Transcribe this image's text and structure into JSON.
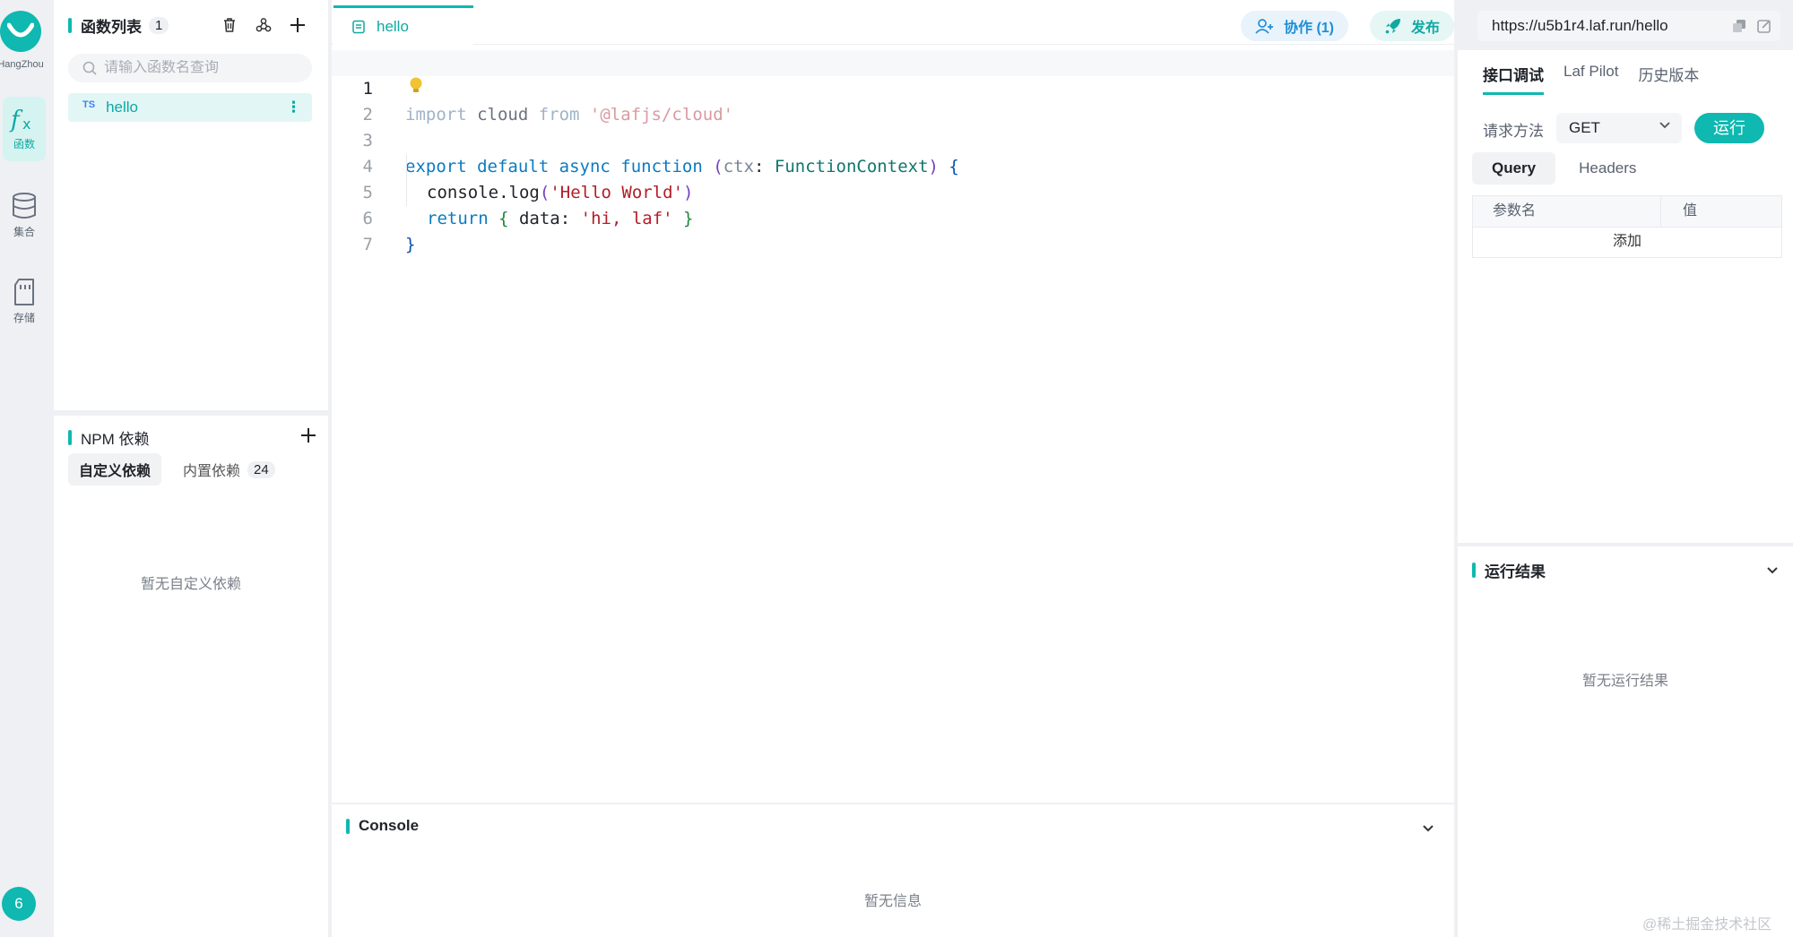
{
  "rail": {
    "region": "HangZhou",
    "items": [
      {
        "label": "函数",
        "active": true
      },
      {
        "label": "集合",
        "active": false
      },
      {
        "label": "存储",
        "active": false
      }
    ],
    "notification_count": "6"
  },
  "function_panel": {
    "title": "函数列表",
    "count": "1",
    "search_placeholder": "请输入函数名查询",
    "functions": [
      {
        "lang": "TS",
        "name": "hello"
      }
    ]
  },
  "npm_panel": {
    "title": "NPM 依赖",
    "tabs": [
      {
        "label": "自定义依赖",
        "active": true
      },
      {
        "label": "内置依赖",
        "count": "24",
        "active": false
      }
    ],
    "empty_text": "暂无自定义依赖"
  },
  "editor": {
    "tab_name": "hello",
    "lines": [
      {
        "n": "1",
        "current": true
      },
      {
        "n": "2"
      },
      {
        "n": "3"
      },
      {
        "n": "4"
      },
      {
        "n": "5"
      },
      {
        "n": "6"
      },
      {
        "n": "7"
      }
    ],
    "tokens": {
      "l1": [
        "import",
        " cloud ",
        "from",
        " '@lafjs/cloud'"
      ],
      "l3": [
        "export",
        " ",
        "default",
        " ",
        "async",
        " ",
        "function",
        " ",
        "(",
        "ctx",
        ": ",
        "FunctionContext",
        ")",
        " ",
        "{"
      ],
      "l4": [
        "console",
        ".",
        "log",
        "(",
        "'Hello World'",
        ")"
      ],
      "l5": [
        "return",
        " ",
        "{",
        " data: ",
        "'hi, laf'",
        " ",
        "}"
      ],
      "l6": [
        "}"
      ]
    }
  },
  "console": {
    "title": "Console",
    "empty_text": "暂无信息"
  },
  "topbar": {
    "collab_label": "协作 (1)",
    "publish_label": "发布",
    "url": "https://u5b1r4.laf.run/hello"
  },
  "debug": {
    "tabs": [
      {
        "label": "接口调试",
        "active": true
      },
      {
        "label": "Laf Pilot",
        "active": false
      },
      {
        "label": "历史版本",
        "active": false
      }
    ],
    "method_label": "请求方法",
    "method_value": "GET",
    "run_label": "运行",
    "param_tabs": [
      {
        "label": "Query",
        "active": true
      },
      {
        "label": "Headers",
        "active": false
      }
    ],
    "param_header": {
      "name": "参数名",
      "value": "值"
    },
    "add_label": "添加"
  },
  "result": {
    "title": "运行结果",
    "empty_text": "暂无运行结果"
  },
  "watermark": "@稀土掘金技术社区",
  "colors": {
    "accent": "#0fb8b0",
    "collab": "#1e8fd6",
    "background": "#eef0f3"
  }
}
